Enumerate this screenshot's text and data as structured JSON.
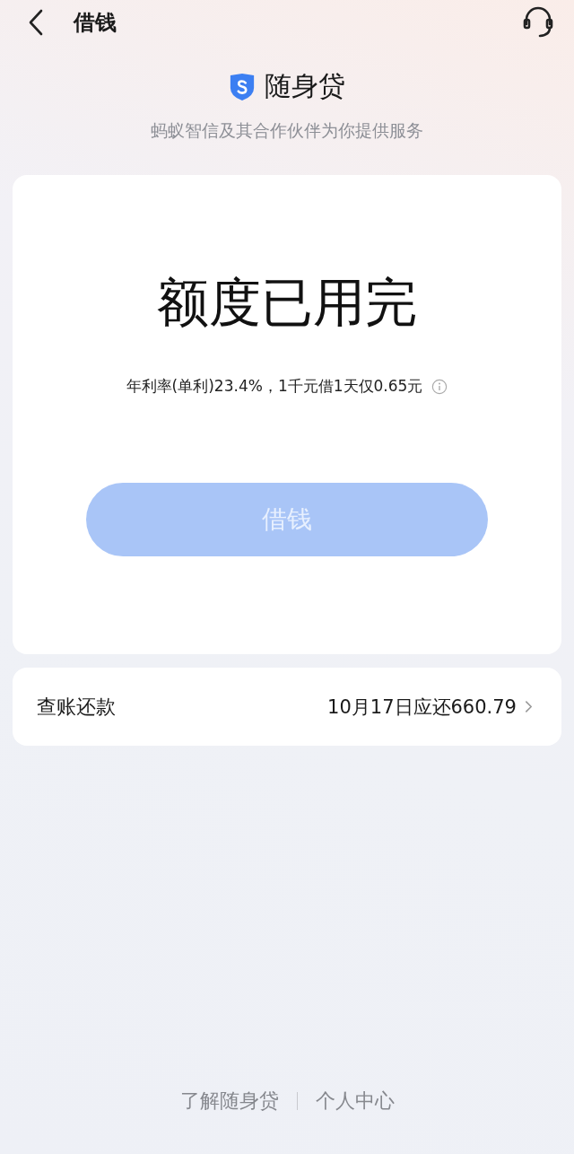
{
  "header": {
    "title": "借钱"
  },
  "brand": {
    "name": "随身贷",
    "subtitle": "蚂蚁智信及其合作伙伴为你提供服务"
  },
  "credit_card": {
    "headline": "额度已用完",
    "rate_note": "年利率(单利)23.4%，1千元借1天仅0.65元",
    "borrow_button": {
      "label": "借钱",
      "disabled": true
    }
  },
  "bill_row": {
    "label": "查账还款",
    "value": "10月17日应还660.79"
  },
  "footer_links": [
    "了解随身贷",
    "个人中心"
  ]
}
